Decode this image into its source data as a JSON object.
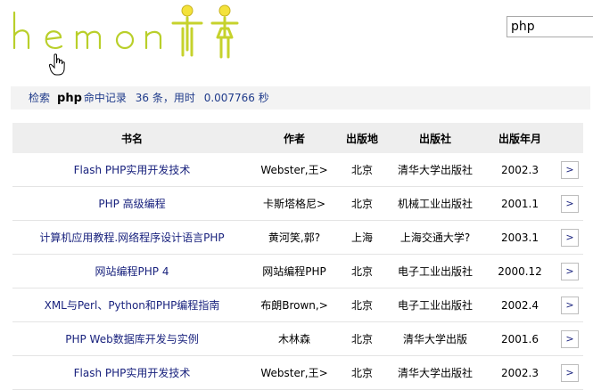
{
  "logo": {
    "text": "hemonti"
  },
  "search": {
    "value": "php"
  },
  "result": {
    "label_search": "检索",
    "keyword": "php",
    "label_hits": "命中记录",
    "count": "36 条",
    "label_time": "用时",
    "time": "0.007766 秒"
  },
  "table": {
    "headers": [
      "书名",
      "作者",
      "出版地",
      "出版社",
      "出版年月"
    ],
    "rows": [
      {
        "title": "Flash PHP实用开发技术",
        "author": "Webster,王>",
        "place": "北京",
        "publisher": "清华大学出版社",
        "date": "2002.3",
        "action": ">"
      },
      {
        "title": "PHP 高级编程",
        "author": "卡斯塔格尼>",
        "place": "北京",
        "publisher": "机械工业出版社",
        "date": "2001.1",
        "action": ">"
      },
      {
        "title": "计算机应用教程.网络程序设计语言PHP",
        "author": "黄河笑,郭?",
        "place": "上海",
        "publisher": "上海交通大学?",
        "date": "2003.1",
        "action": ">"
      },
      {
        "title": "网站编程PHP 4",
        "author": "网站编程PHP",
        "place": "北京",
        "publisher": "电子工业出版社",
        "date": "2000.12",
        "action": ">"
      },
      {
        "title": "XML与Perl、Python和PHP编程指南",
        "author": "布朗Brown,>",
        "place": "北京",
        "publisher": "电子工业出版社",
        "date": "2002.4",
        "action": ">"
      },
      {
        "title": "PHP Web数据库开发与实例",
        "author": "木林森",
        "place": "北京",
        "publisher": "清华大学出版",
        "date": "2001.6",
        "action": ">"
      },
      {
        "title": "Flash PHP实用开发技术",
        "author": "Webster,王>",
        "place": "北京",
        "publisher": "清华大学出版社",
        "date": "2002.3",
        "action": ">"
      }
    ]
  }
}
